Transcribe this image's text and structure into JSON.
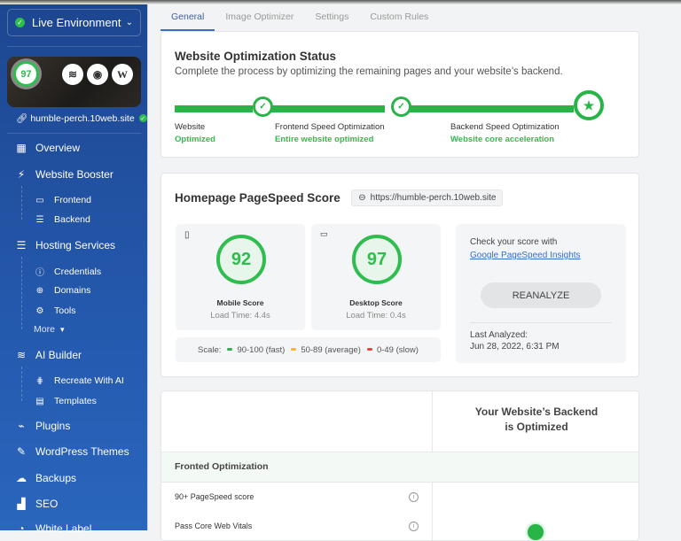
{
  "sidebar": {
    "environment": "Live Environment",
    "site_score": "97",
    "site_url": "humble-perch.10web.site",
    "items": [
      {
        "label": "Overview",
        "icon": "grid-icon"
      },
      {
        "label": "Website Booster",
        "icon": "bolt-icon"
      },
      {
        "label": "Frontend",
        "icon": "laptop-icon"
      },
      {
        "label": "Backend",
        "icon": "server-icon"
      },
      {
        "label": "Hosting Services",
        "icon": "server-icon"
      },
      {
        "label": "Credentials",
        "icon": "info-icon"
      },
      {
        "label": "Domains",
        "icon": "globe-icon"
      },
      {
        "label": "Tools",
        "icon": "tools-icon"
      },
      {
        "label": "More",
        "icon": "chevron-down-icon"
      },
      {
        "label": "AI Builder",
        "icon": "layers-icon"
      },
      {
        "label": "Recreate With AI",
        "icon": "ai-icon"
      },
      {
        "label": "Templates",
        "icon": "template-icon"
      },
      {
        "label": "Plugins",
        "icon": "plug-icon"
      },
      {
        "label": "WordPress Themes",
        "icon": "brush-icon"
      },
      {
        "label": "Backups",
        "icon": "cloud-icon"
      },
      {
        "label": "SEO",
        "icon": "chart-icon"
      },
      {
        "label": "White Label",
        "icon": "label-icon"
      }
    ]
  },
  "tabs": [
    "General",
    "Image Optimizer",
    "Settings",
    "Custom Rules"
  ],
  "status": {
    "title": "Website Optimization Status",
    "subtitle": "Complete the process by optimizing the remaining pages and your website’s backend.",
    "steps": [
      {
        "name": "Website",
        "state": "Optimized"
      },
      {
        "name": "Frontend Speed Optimization",
        "state": "Entire website optimized"
      },
      {
        "name": "Backend Speed Optimization",
        "state": "Website core acceleration"
      }
    ],
    "progress_percent": 100
  },
  "pagespeed": {
    "title": "Homepage PageSpeed Score",
    "url": "https://humble-perch.10web.site",
    "mobile": {
      "score": "92",
      "label": "Mobile Score",
      "load": "Load Time: 4.4s"
    },
    "desktop": {
      "score": "97",
      "label": "Desktop Score",
      "load": "Load Time: 0.4s"
    },
    "scale": {
      "label": "Scale:",
      "fast": "90-100 (fast)",
      "average": "50-89 (average)",
      "slow": "0-49 (slow)"
    },
    "check_text": "Check your score with",
    "check_link": "Google PageSpeed Insights",
    "reanalyze": "REANALYZE",
    "last_label": "Last Analyzed:",
    "last_value": "Jun 28, 2022, 6:31 PM"
  },
  "compare": {
    "heading_line1": "Your Website’s Backend",
    "heading_line2": "is Optimized",
    "section": "Fronted Optimization",
    "rows": [
      "90+ PageSpeed score",
      "Pass Core Web Vitals"
    ]
  },
  "colors": {
    "green": "#28b446",
    "yellow": "#f4b33a",
    "red": "#e8443a",
    "sidebar": "#2459ad"
  }
}
